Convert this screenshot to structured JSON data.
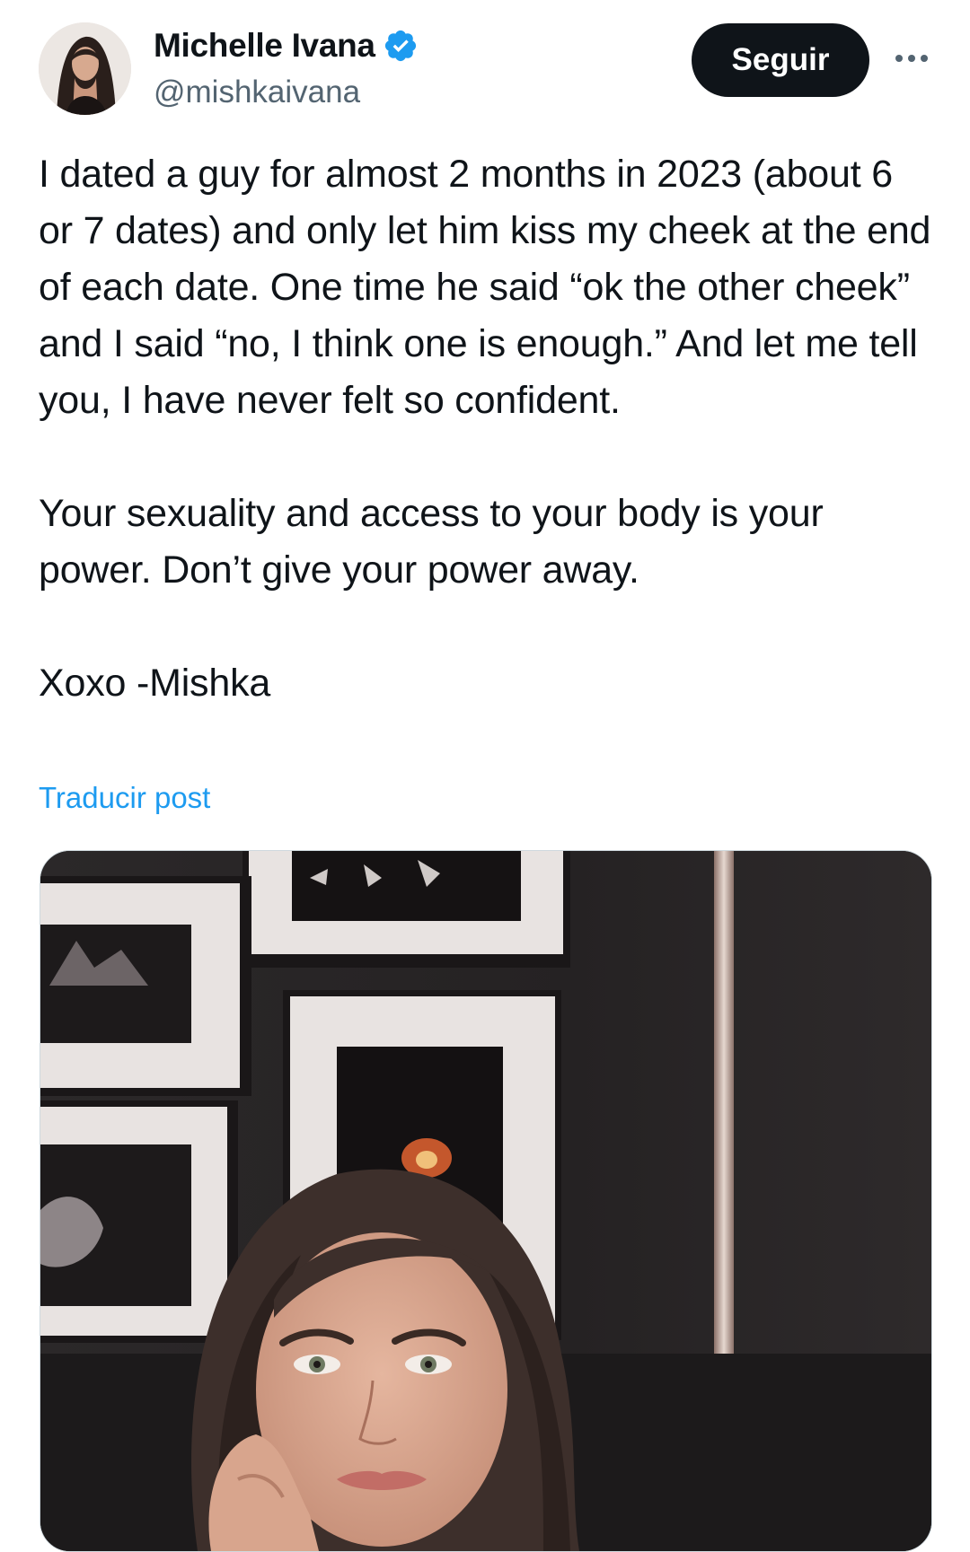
{
  "author": {
    "display_name": "Michelle Ivana",
    "handle": "@mishkaivana",
    "verified": true,
    "verified_color": "#1d9bf0"
  },
  "actions": {
    "follow_label": "Seguir",
    "more_icon": "more-horizontal-icon"
  },
  "tweet": {
    "paragraphs": [
      "I dated a guy for almost 2 months in 2023 (about 6 or 7 dates) and only let him kiss my cheek at the end of each date. One time he said “ok the other cheek” and I said “no, I think one is enough.” And let me tell you, I have never felt so confident.",
      "Your sexuality and access to your body is your power. Don’t give your power away.",
      "Xoxo -Mishka"
    ],
    "translate_label": "Traducir post"
  },
  "colors": {
    "text": "#0f1419",
    "secondary": "#536471",
    "link": "#1d9bf0",
    "button_bg": "#0f1419"
  }
}
